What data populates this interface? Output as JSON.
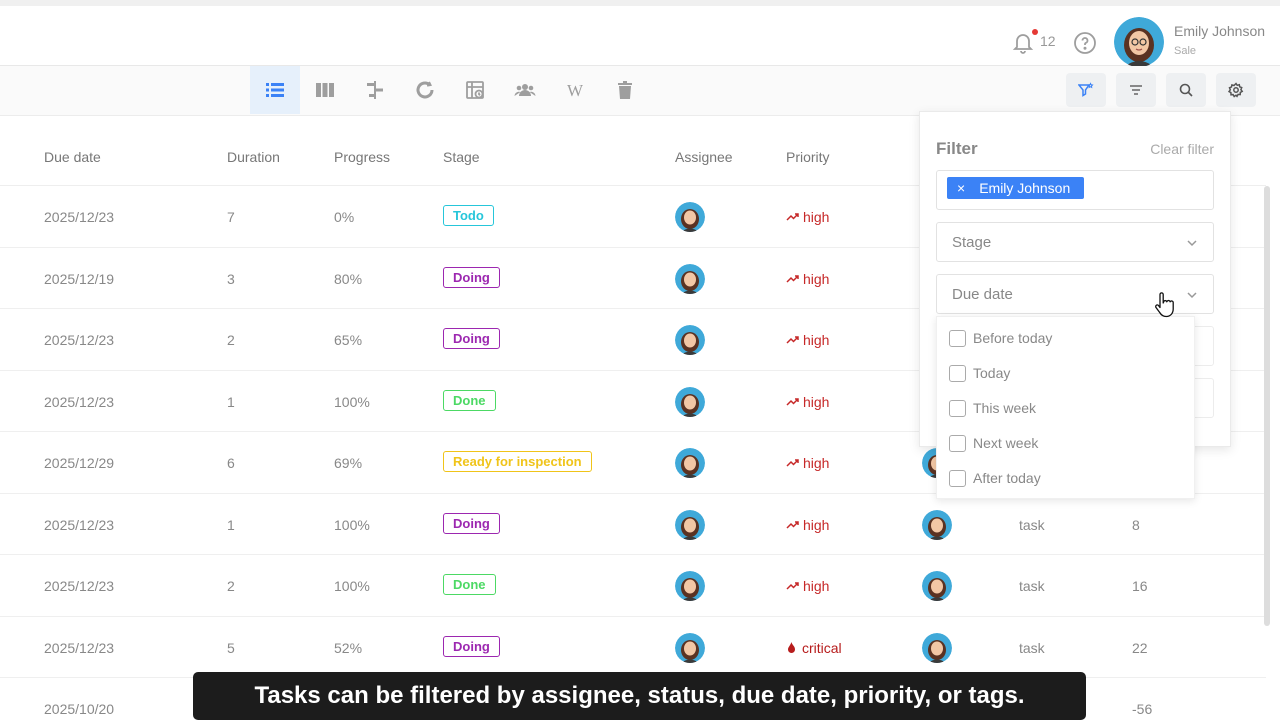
{
  "header": {
    "notification_count": "12",
    "user_name": "Emily Johnson",
    "user_role": "Sale"
  },
  "toolbar": {
    "views": [
      "list-view-icon",
      "board-view-icon",
      "gantt-view-icon",
      "cycle-view-icon",
      "calendar-view-icon",
      "team-view-icon",
      "wiki-view-icon",
      "trash-icon"
    ],
    "active_view": "list-view-icon",
    "tools": [
      "filter-active-icon",
      "sort-icon",
      "search-icon",
      "settings-icon"
    ]
  },
  "table": {
    "columns": {
      "due_date": "Due date",
      "duration": "Duration",
      "progress": "Progress",
      "stage": "Stage",
      "assignee": "Assignee",
      "priority": "Priority"
    },
    "rows": [
      {
        "due_date": "2025/12/23",
        "duration": "7",
        "progress": "0%",
        "stage": "Todo",
        "priority": "high",
        "type": "",
        "number": ""
      },
      {
        "due_date": "2025/12/19",
        "duration": "3",
        "progress": "80%",
        "stage": "Doing",
        "priority": "high",
        "type": "",
        "number": ""
      },
      {
        "due_date": "2025/12/23",
        "duration": "2",
        "progress": "65%",
        "stage": "Doing",
        "priority": "high",
        "type": "",
        "number": ""
      },
      {
        "due_date": "2025/12/23",
        "duration": "1",
        "progress": "100%",
        "stage": "Done",
        "priority": "high",
        "type": "",
        "number": ""
      },
      {
        "due_date": "2025/12/29",
        "duration": "6",
        "progress": "69%",
        "stage": "Ready for inspection",
        "priority": "high",
        "type": "",
        "number": ""
      },
      {
        "due_date": "2025/12/23",
        "duration": "1",
        "progress": "100%",
        "stage": "Doing",
        "priority": "high",
        "type": "task",
        "number": "8"
      },
      {
        "due_date": "2025/12/23",
        "duration": "2",
        "progress": "100%",
        "stage": "Done",
        "priority": "high",
        "type": "task",
        "number": "16"
      },
      {
        "due_date": "2025/12/23",
        "duration": "5",
        "progress": "52%",
        "stage": "Doing",
        "priority": "critical",
        "type": "task",
        "number": "22"
      },
      {
        "due_date": "2025/10/20",
        "duration": "",
        "progress": "",
        "stage": "",
        "priority": "",
        "type": "",
        "number": "-56"
      }
    ],
    "stage_colors": {
      "Todo": "#26c6da",
      "Doing": "#9c27b0",
      "Done": "#4cd964",
      "Ready for inspection": "#f0c419"
    },
    "priority_colors": {
      "high": "#c62828",
      "critical": "#b71c1c"
    }
  },
  "filter": {
    "title": "Filter",
    "clear_label": "Clear filter",
    "assignee_tag": "Emily Johnson",
    "stage_placeholder": "Stage",
    "due_date_placeholder": "Due date",
    "due_date_options": [
      "Before today",
      "Today",
      "This week",
      "Next week",
      "After today"
    ]
  },
  "caption": "Tasks can be filtered by assignee, status, due date, priority, or tags.",
  "colors": {
    "accent": "#3b82f6",
    "active_view_bg": "#e6f0fb"
  }
}
